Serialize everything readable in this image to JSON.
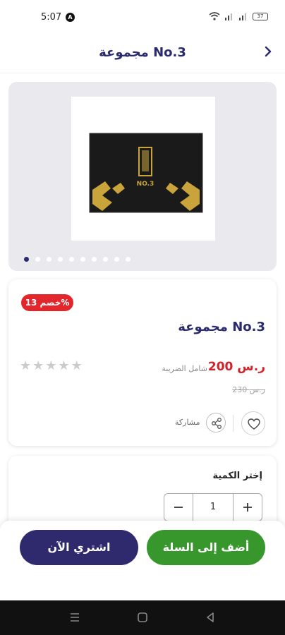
{
  "status_bar": {
    "time": "5:07",
    "battery": "37"
  },
  "header": {
    "title": "مجموعة  No.3"
  },
  "gallery": {
    "dot_count": 10,
    "active_index": 0
  },
  "product": {
    "discount_badge": "خصم 13%",
    "title": "مجموعة  No.3",
    "price": "200 ر.س",
    "tax_note": "شامل الضريبة",
    "old_price": "230 ر.س",
    "rating": 0,
    "max_rating": 5,
    "share_label": "مشاركة"
  },
  "quantity": {
    "label": "إختر الكمية",
    "value": "1"
  },
  "actions": {
    "add_to_cart": "أضف إلى السلة",
    "buy_now": "اشتري الآن"
  },
  "colors": {
    "brand": "#2a2a6e",
    "price_red": "#d3232a",
    "cart_green": "#37972c",
    "buy_navy": "#2f2a6e",
    "badge_red": "#e3262c"
  }
}
